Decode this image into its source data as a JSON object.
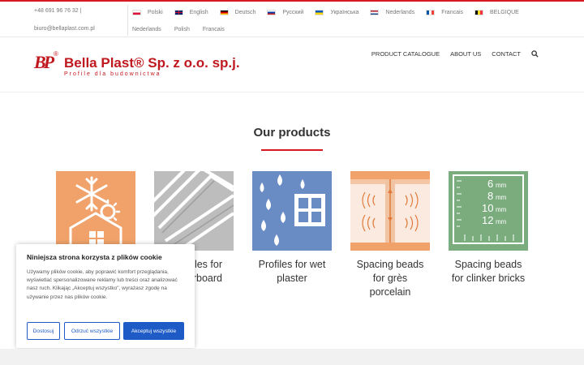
{
  "topbar": {
    "phone": "+48 691 96 76 32",
    "separator": "|",
    "email": "biuro@bellaplast.com.pl",
    "languages": [
      {
        "label": "Polski",
        "flag": "poland-flag-icon"
      },
      {
        "label": "English",
        "flag": "uk-flag-icon"
      },
      {
        "label": "Deutsch",
        "flag": "germany-flag-icon"
      },
      {
        "label": "Русский",
        "flag": "russia-flag-icon"
      },
      {
        "label": "Українська",
        "flag": "ukraine-flag-icon"
      },
      {
        "label": "Nederlands",
        "flag": "netherlands-flag-icon"
      },
      {
        "label": "Francais",
        "flag": "france-flag-icon"
      },
      {
        "label": "BELGIQUE",
        "flag": "belgium-flag-icon"
      }
    ],
    "languages_row2": [
      "Nederlands",
      "Polish",
      "Francais"
    ]
  },
  "logo": {
    "mark": "BP",
    "registered": "®",
    "name": "Bella Plast® Sp. z o.o. sp.j.",
    "tagline": "Profile dla budownictwa"
  },
  "nav": {
    "items": [
      "PRODUCT CATALOGUE",
      "ABOUT US",
      "CONTACT"
    ],
    "search_icon": "search-icon"
  },
  "products": {
    "title": "Our products",
    "items": [
      {
        "caption": "",
        "icon": "snowflake-sun-house-icon"
      },
      {
        "caption": "les for\nrboard",
        "icon": "plasterboard-sheets-icon"
      },
      {
        "caption": "Profiles for wet\nplaster",
        "icon": "water-drops-window-icon"
      },
      {
        "caption": "Spacing beads\nfor grès\nporcelain",
        "icon": "tile-spacing-bead-icon"
      },
      {
        "caption": "Spacing beads\nfor clinker bricks",
        "icon": "clinker-sizes-icon"
      }
    ],
    "clinker_sizes": [
      "6",
      "8",
      "10",
      "12"
    ],
    "clinker_unit": "mm"
  },
  "cookie": {
    "title": "Niniejsza strona korzysta z plików cookie",
    "body": "Używamy plików cookie, aby poprawić komfort przeglądania, wyświetlać spersonalizowane reklamy lub treści oraz analizować nasz ruch. Klikając „Akceptuj wszystko\", wyrażasz zgodę na używanie przez nas plików cookie.",
    "buttons": {
      "customize": "Dostosuj",
      "reject": "Odrzuć wszystkie",
      "accept": "Akceptuj wszystkie"
    }
  },
  "colors": {
    "brand": "#d71920",
    "orange": "#f0a26a",
    "blue": "#6a8cc5",
    "green": "#7aac7e",
    "button": "#1e5bc6"
  }
}
